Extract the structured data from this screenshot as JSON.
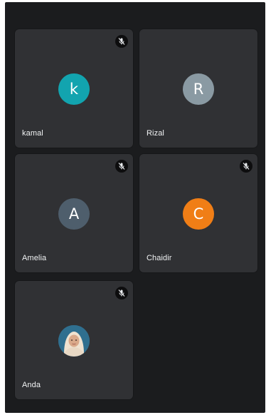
{
  "participants": [
    {
      "name": "kamal",
      "initial": "k",
      "avatar_color": "#12a4af",
      "muted": true,
      "mute_icon": "mic-off-icon"
    },
    {
      "name": "Rizal",
      "initial": "R",
      "avatar_color": "#8a9aa3",
      "muted": false
    },
    {
      "name": "Amelia",
      "initial": "A",
      "avatar_color": "#4e5e6c",
      "muted": true,
      "mute_icon": "mic-off-icon"
    },
    {
      "name": "Chaidir",
      "initial": "C",
      "avatar_color": "#f07e16",
      "muted": true,
      "mute_icon": "mic-off-icon"
    },
    {
      "name": "Anda",
      "avatar_type": "photo",
      "muted": true,
      "mute_icon": "mic-off-icon"
    }
  ],
  "colors": {
    "background": "#1b1c1e",
    "tile": "#303134",
    "text": "#f1f3f4"
  }
}
